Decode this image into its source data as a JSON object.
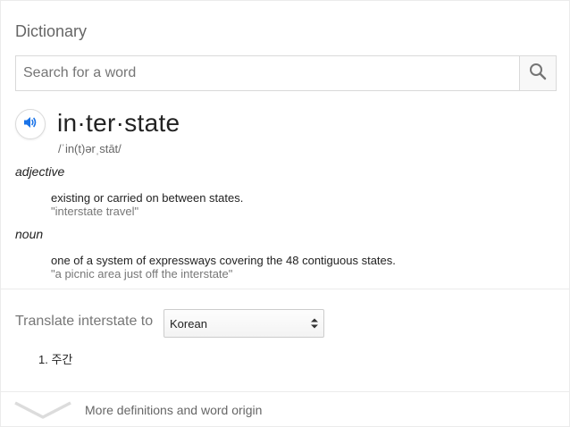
{
  "card": {
    "title": "Dictionary"
  },
  "search": {
    "placeholder": "Search for a word",
    "value": "",
    "icon": "search-icon"
  },
  "entry": {
    "speaker_icon": "speaker-icon",
    "word": "in·ter·state",
    "phonetic": "/ˈin(t)ərˌstāt/",
    "senses": [
      {
        "part_of_speech": "adjective",
        "definition": "existing or carried on between states.",
        "example": "\"interstate travel\""
      },
      {
        "part_of_speech": "noun",
        "definition": "one of a system of expressways covering the 48 contiguous states.",
        "example": "\"a picnic area just off the interstate\""
      }
    ]
  },
  "translate": {
    "label": "Translate interstate to",
    "selected_language": "Korean",
    "results": [
      "1. 주간"
    ]
  },
  "more": {
    "label": "More definitions and word origin",
    "icon": "chevron-down-icon"
  },
  "colors": {
    "accent_blue": "#1a73e8",
    "muted_text": "#777777",
    "border": "#d9d9d9"
  }
}
